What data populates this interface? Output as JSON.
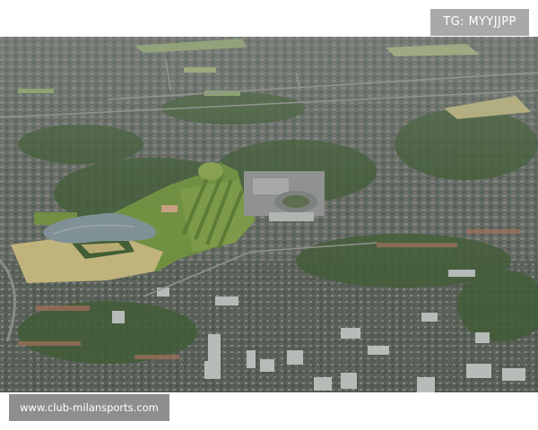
{
  "overlays": {
    "tag": "TG: MYYJJPP",
    "watermark": "www.club-milansports.com"
  },
  "colors": {
    "tag_background": "#a9a9a9",
    "watermark_background": "#8e8e8e",
    "overlay_text": "#ffffff",
    "urban_base": "#5f6660",
    "tree_green": "#3f5a34",
    "field_tan": "#c2b47a",
    "grass_green": "#6e8f3c",
    "lake_water": "#7d8f96",
    "tower_gray": "#b7bcb8"
  }
}
